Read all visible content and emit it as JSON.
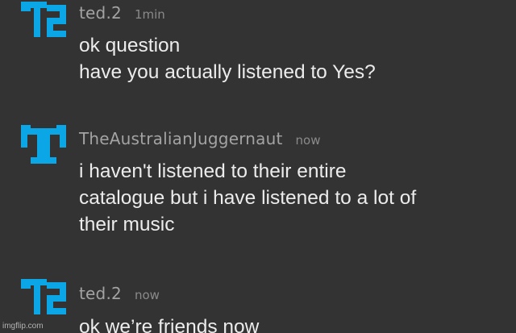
{
  "messages": [
    {
      "username": "ted.2",
      "time": "1min",
      "lines": [
        "ok question",
        "have you actually listened to Yes?"
      ],
      "avatar_icon": "t2-pixel-logo-icon"
    },
    {
      "username": "TheAustralianJuggernaut",
      "time": "now",
      "lines": [
        "i haven't listened to their entire",
        "catalogue but i have listened to a lot of",
        "their music"
      ],
      "avatar_icon": "pixel-t-logo-icon"
    },
    {
      "username": "ted.2",
      "time": "now",
      "lines": [
        "ok we’re friends now"
      ],
      "avatar_icon": "t2-pixel-logo-icon"
    }
  ],
  "watermark": "imgflip.com",
  "colors": {
    "background": "#333333",
    "avatar": "#0aa6e6",
    "username": "#a3a3a3",
    "timestamp": "#8a8a8a",
    "text": "#ececec"
  }
}
